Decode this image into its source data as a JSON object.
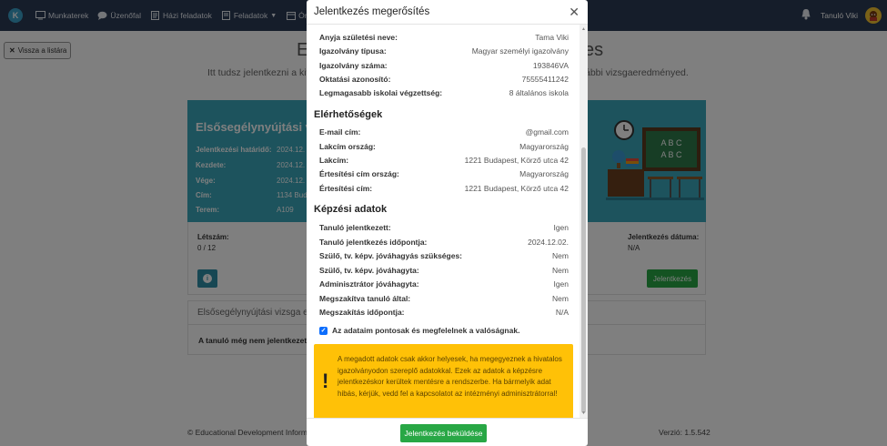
{
  "navbar": {
    "logo": "K",
    "items": [
      {
        "label": "Munkaterek",
        "icon": "monitor-icon"
      },
      {
        "label": "Üzenőfal",
        "icon": "chat-icon"
      },
      {
        "label": "Házi feladatok",
        "icon": "document-icon"
      },
      {
        "label": "Feladatok",
        "icon": "document-icon"
      },
      {
        "label": "Órare",
        "icon": "calendar-icon"
      }
    ],
    "user_name": "Tanuló Viki"
  },
  "background": {
    "back_label": "Vissza a listára",
    "title_left": "E",
    "title_right": "es",
    "subtitle_left": "Itt tudsz jelentkezni a kiv",
    "subtitle_right": "ábbi vizsgaeredményed.",
    "exam": {
      "title": "Elsősegélynyújtási v",
      "rows": [
        {
          "k": "Jelentkezési határidő:",
          "v": "2024.12."
        },
        {
          "k": "Kezdete:",
          "v": "2024.12."
        },
        {
          "k": "Vége:",
          "v": "2024.12."
        },
        {
          "k": "Cím:",
          "v": "1134 Bud"
        },
        {
          "k": "Terem:",
          "v": "A109"
        }
      ],
      "board_text": "A B C\nA B C"
    },
    "stats": {
      "count_label": "Létszám:",
      "count_value": "0 / 12",
      "date_label": "Jelentkezés dátuma:",
      "date_value": "N/A",
      "register_label": "Jelentkezés"
    },
    "exam_box": {
      "header": "Elsősegélynyújtási vizsga e",
      "message": "A tanuló még nem jelentkezett a"
    },
    "footer_left": "© Educational Development Informa",
    "footer_right": "Verzió: 1.5.542"
  },
  "modal": {
    "title": "Jelentkezés megerősítés",
    "personal_rows": [
      {
        "k": "Anyja születési neve:",
        "v": "Tama Viki"
      },
      {
        "k": "Igazolvány típusa:",
        "v": "Magyar személyi igazolvány"
      },
      {
        "k": "Igazolvány száma:",
        "v": "193846VA"
      },
      {
        "k": "Oktatási azonosító:",
        "v": "75555411242"
      },
      {
        "k": "Legmagasabb iskolai végzettség:",
        "v": "8 általános iskola"
      }
    ],
    "contact_title": "Elérhetőségek",
    "contact_rows": [
      {
        "k": "E-mail cím:",
        "v": "@gmail.com"
      },
      {
        "k": "Lakcím ország:",
        "v": "Magyarország"
      },
      {
        "k": "Lakcím:",
        "v": "1221 Budapest, Körző utca 42"
      },
      {
        "k": "Értesítési cím ország:",
        "v": "Magyarország"
      },
      {
        "k": "Értesítési cím:",
        "v": "1221 Budapest, Körző utca 42"
      }
    ],
    "training_title": "Képzési adatok",
    "training_rows": [
      {
        "k": "Tanuló jelentkezett:",
        "v": "Igen"
      },
      {
        "k": "Tanuló jelentkezés időpontja:",
        "v": "2024.12.02."
      },
      {
        "k": "Szülő, tv. képv. jóváhagyás szükséges:",
        "v": "Nem"
      },
      {
        "k": "Szülő, tv. képv. jóváhagyta:",
        "v": "Nem"
      },
      {
        "k": "Adminisztrátor jóváhagyta:",
        "v": "Igen"
      },
      {
        "k": "Megszakítva tanuló által:",
        "v": "Nem"
      },
      {
        "k": "Megszakítás időpontja:",
        "v": "N/A"
      }
    ],
    "consent_label": "Az adataim pontosak és megfelelnek a valóságnak.",
    "consent_checked": true,
    "warning_text": "A megadott adatok csak akkor helyesek, ha megegyeznek a hivatalos igazolványodon szereplő adatokkal. Ezek az adatok a képzésre jelentkezéskor kerültek mentésre a rendszerbe. Ha bármelyik adat hibás, kérjük, vedd fel a kapcsolatot az intézményi adminisztrátorral!",
    "submit_label": "Jelentkezés beküldése"
  },
  "colors": {
    "navbar": "#2b3a55",
    "exam_card": "#3aa7bb",
    "primary_button": "#28a745",
    "warning": "#ffc107"
  }
}
